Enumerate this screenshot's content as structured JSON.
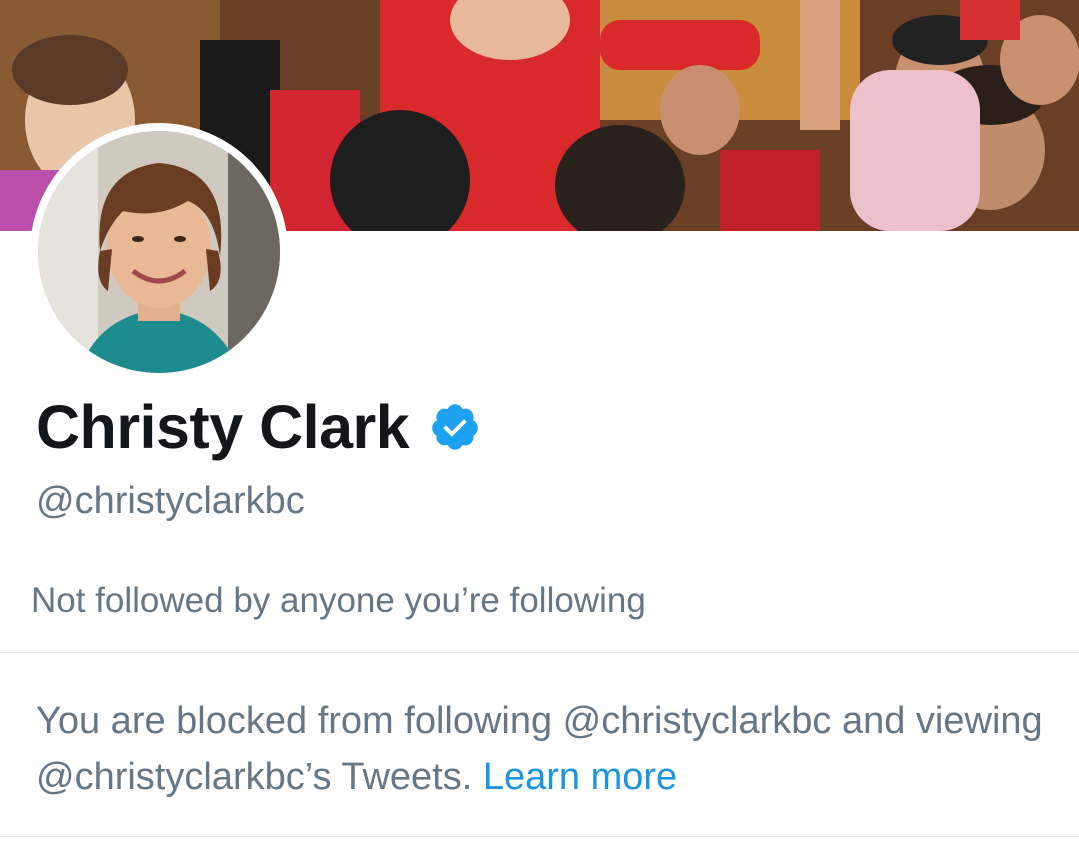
{
  "profile": {
    "name": "Christy Clark",
    "handle": "@christyclarkbc",
    "verified": true,
    "followed_by": "Not followed by anyone you’re following"
  },
  "notice": {
    "text": "You are blocked from following @christyclarkbc and viewing @christyclarkbc’s Tweets.",
    "link_label": "Learn more"
  },
  "colors": {
    "name": "#14171a",
    "secondary": "#657786",
    "link": "#1b95e0",
    "verified": "#1da1f2",
    "divider": "#dcdfe2"
  },
  "icons": {
    "verified": "verified-badge-icon"
  }
}
